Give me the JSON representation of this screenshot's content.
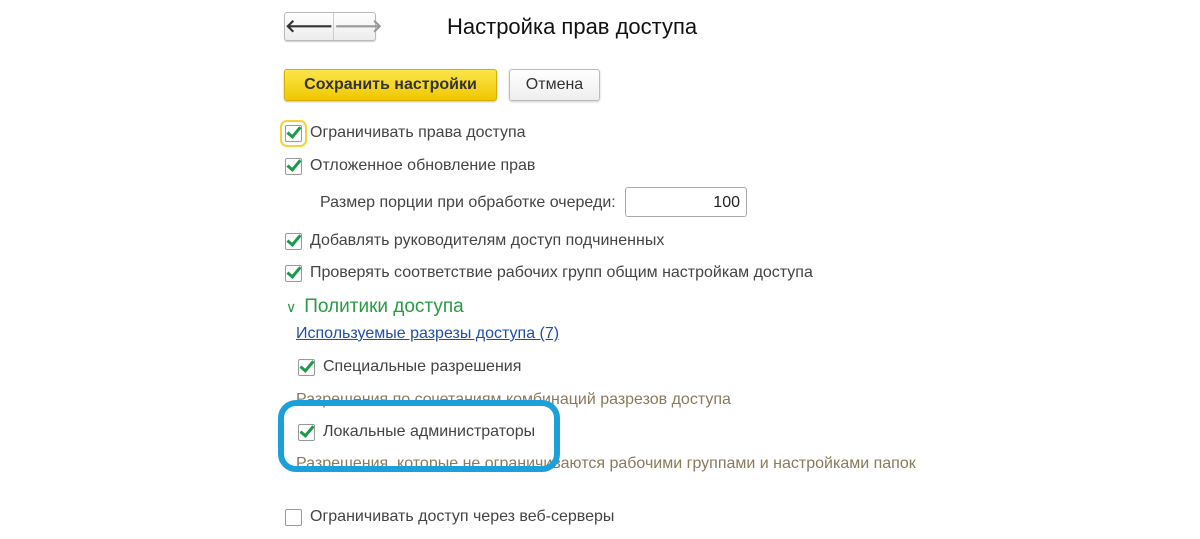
{
  "header": {
    "title": "Настройка прав доступа",
    "back_icon": "arrow-left",
    "forward_icon": "arrow-right"
  },
  "toolbar": {
    "save_label": "Сохранить настройки",
    "cancel_label": "Отмена"
  },
  "options": {
    "restrict_access": {
      "label": "Ограничивать права доступа",
      "checked": true
    },
    "deferred_update": {
      "label": "Отложенное обновление прав",
      "checked": true
    },
    "batch_size": {
      "label": "Размер порции при обработке очереди:",
      "value": "100"
    },
    "managers_access": {
      "label": "Добавлять руководителям доступ подчиненных",
      "checked": true
    },
    "check_workgroups": {
      "label": "Проверять соответствие рабочих групп общим настройкам доступа",
      "checked": true
    }
  },
  "policies": {
    "title": "Политики доступа",
    "link": "Используемые разрезы доступа (7)",
    "special": {
      "label": "Специальные разрешения",
      "checked": true,
      "note": "Разрешения по сочетаниям комбинаций разрезов доступа"
    },
    "local_admins": {
      "label": "Локальные администраторы",
      "checked": true,
      "note": "Разрешения, которые не ограничиваются рабочими группами и настройками папок"
    }
  },
  "web": {
    "label": "Ограничивать доступ через веб-серверы",
    "checked": false
  },
  "colors": {
    "highlight": "#1ca0dc",
    "accent": "#f0c800",
    "group": "#2a9a44"
  }
}
